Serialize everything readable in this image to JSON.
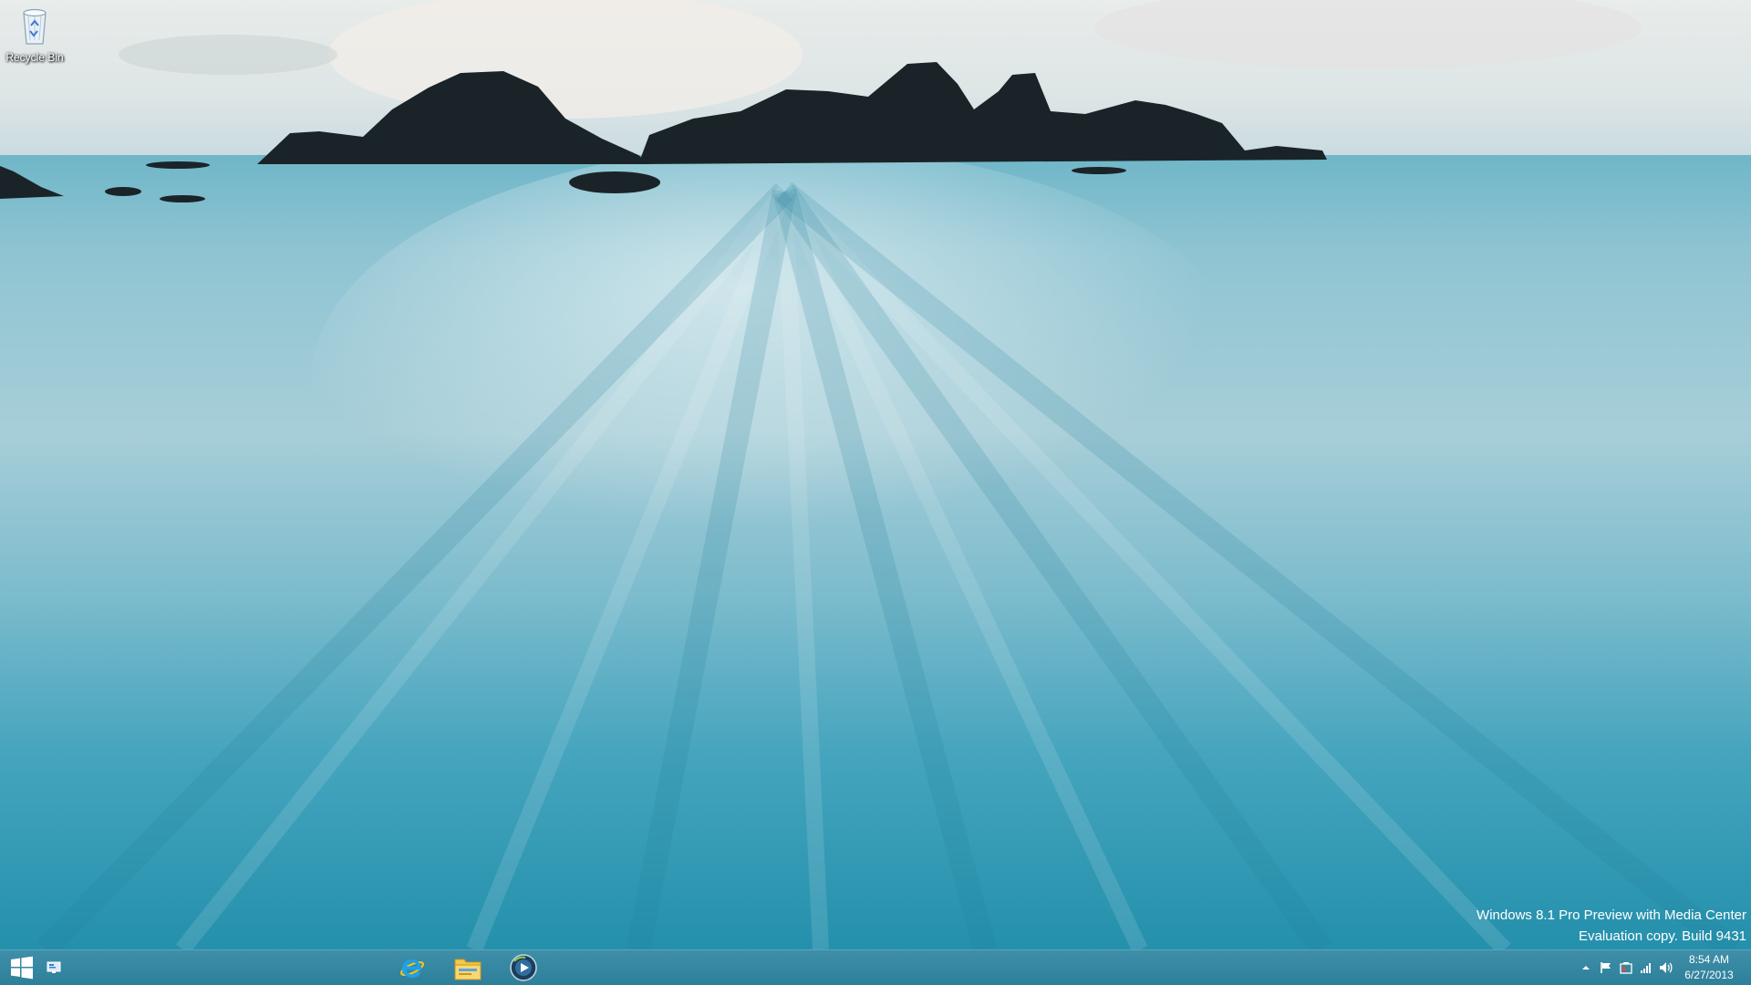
{
  "desktop": {
    "icons": [
      {
        "label": "Recycle Bin",
        "icon": "recycle-bin-icon"
      }
    ]
  },
  "watermark": {
    "line1": "Windows 8.1 Pro Preview with Media Center",
    "line2": "Evaluation copy. Build 9431"
  },
  "taskbar": {
    "start_icon": "windows-logo-icon",
    "desktop_shortcut_icon": "desktop-icon",
    "pinned": [
      {
        "app": "Internet Explorer",
        "icon": "internet-explorer-icon"
      },
      {
        "app": "File Explorer",
        "icon": "file-explorer-icon"
      },
      {
        "app": "Windows Media Center",
        "icon": "media-center-icon"
      }
    ],
    "tray": {
      "icons": [
        "chevron-up-icon",
        "action-center-flag-icon",
        "power-icon",
        "network-signal-icon",
        "speaker-icon"
      ],
      "time": "8:54 AM",
      "date": "6/27/2013"
    }
  },
  "colors": {
    "taskbar": "#2d7f9a",
    "sea": "#2b98b3",
    "rocks": "#1a2428"
  }
}
